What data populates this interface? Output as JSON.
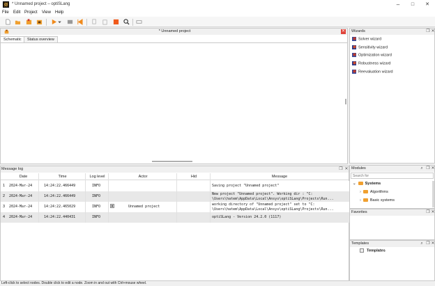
{
  "window": {
    "title": "* Unnamed project – optiSLang",
    "controls": [
      "–",
      "□",
      "✕"
    ]
  },
  "menubar": [
    "File",
    "Edit",
    "Project",
    "View",
    "Help"
  ],
  "main_panel": {
    "title": "* Unnamed project",
    "tabs": [
      "Schematic",
      "Status overview"
    ]
  },
  "wizards": {
    "title": "Wizards",
    "items": [
      "Solver wizard",
      "Sensitivity wizard",
      "Optimization wizard",
      "Robustness wizard",
      "Reevaluation wizard"
    ]
  },
  "message_log": {
    "title": "Message log",
    "columns": [
      "Date",
      "Time",
      "Log level",
      "Actor",
      "Hid",
      "Message"
    ],
    "rows": [
      {
        "num": "1",
        "date": "2024-Mar-24",
        "time": "14:24:22.466449",
        "level": "INFO",
        "actor": "",
        "hid": "",
        "message": [
          "Saving project \"Unnamed project\""
        ]
      },
      {
        "num": "2",
        "date": "2024-Mar-24",
        "time": "14:24:22.466449",
        "level": "INFO",
        "actor": "",
        "hid": "",
        "message": [
          "New project \"Unnamed project\". Working dir : \"C:",
          "\\Users\\hatem\\AppData\\Local\\Ansys\\optiSLang\\Projects\\Run..."
        ]
      },
      {
        "num": "3",
        "date": "2024-Mar-24",
        "time": "14:24:22.465029",
        "level": "INFO",
        "actor": "Unnamed project",
        "hid": "",
        "message": [
          "working directory of \"Unnamed project\" set to \"C:",
          "\\Users\\hatem\\AppData\\Local\\Ansys\\optiSLang\\Projects\\Run..."
        ]
      },
      {
        "num": "4",
        "date": "2024-Mar-24",
        "time": "14:24:22.440431",
        "level": "INFO",
        "actor": "",
        "hid": "",
        "message": [
          "optiSLang - Version 24.2.0 (1117)"
        ]
      }
    ]
  },
  "modules": {
    "title": "Modules",
    "search_placeholder": "Search for",
    "tree": [
      {
        "label": "Systems",
        "level": 0,
        "bold": true
      },
      {
        "label": "Algorithms",
        "level": 1,
        "bold": false
      },
      {
        "label": "Basic systems",
        "level": 1,
        "bold": false
      }
    ]
  },
  "favorites": {
    "title": "Favorites"
  },
  "templates": {
    "title": "Templates",
    "item": "Templates"
  },
  "statusbar": {
    "text": "Left-click to select nodes. Double click to edit a node. Zoom in and out with Ctrl+mouse wheel."
  },
  "colors": {
    "accent_orange": "#f08a1c",
    "close_red": "#e0433a",
    "selection": "#e8e8e8"
  }
}
